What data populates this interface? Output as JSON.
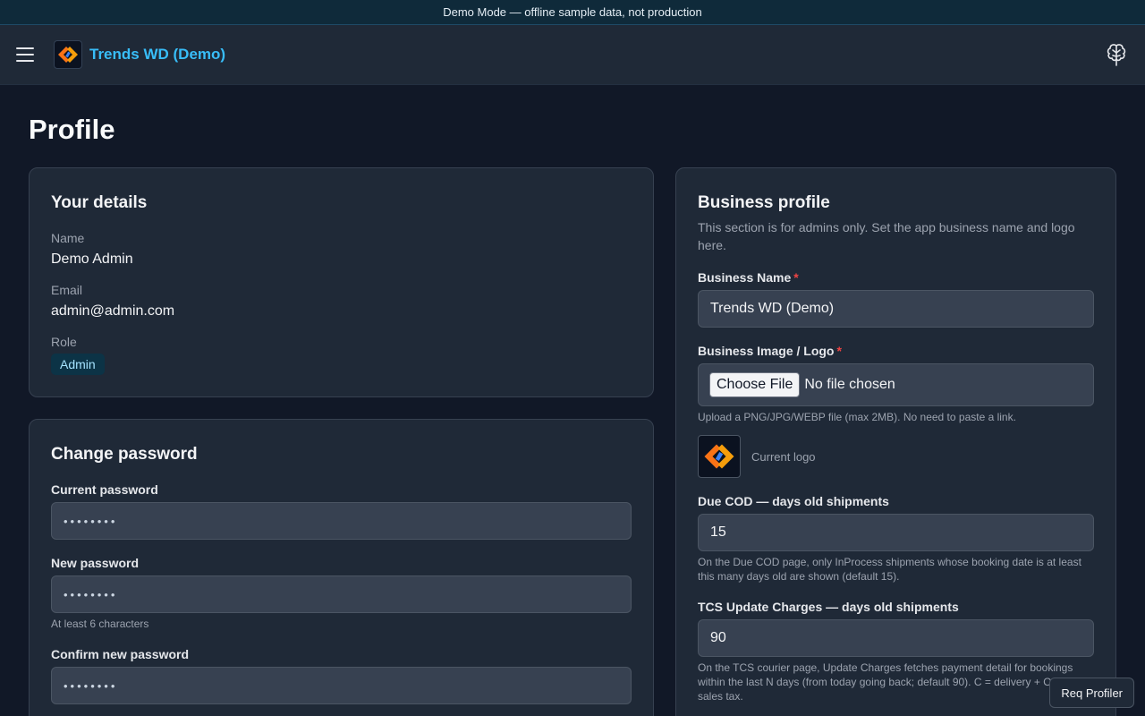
{
  "banner": {
    "text": "Demo Mode — offline sample data, not production"
  },
  "header": {
    "brand_name": "Trends WD (Demo)",
    "menu_icon": "hamburger-icon",
    "user_icon": "brain-icon"
  },
  "page": {
    "title": "Profile"
  },
  "details": {
    "title": "Your details",
    "name_label": "Name",
    "name_value": "Demo Admin",
    "email_label": "Email",
    "email_value": "admin@admin.com",
    "role_label": "Role",
    "role_value": "Admin"
  },
  "password": {
    "title": "Change password",
    "current_label": "Current password",
    "current_value": "••••••••",
    "new_label": "New password",
    "new_value": "••••••••",
    "new_help": "At least 6 characters",
    "confirm_label": "Confirm new password",
    "confirm_value": "••••••••"
  },
  "business": {
    "title": "Business profile",
    "description": "This section is for admins only. Set the app business name and logo here.",
    "name_label": "Business Name",
    "name_value": "Trends WD (Demo)",
    "logo_label": "Business Image / Logo",
    "file_button": "Choose File",
    "file_status": "No file chosen",
    "upload_help": "Upload a PNG/JPG/WEBP file (max 2MB). No need to paste a link.",
    "current_logo_label": "Current logo",
    "due_cod_label": "Due COD — days old shipments",
    "due_cod_value": "15",
    "due_cod_help": "On the Due COD page, only InProcess shipments whose booking date is at least this many days old are shown (default 15).",
    "tcs_label": "TCS Update Charges — days old shipments",
    "tcs_value": "90",
    "tcs_help": "On the TCS courier page, Update Charges fetches payment detail for bookings within the last N days (from today going back; default 90). C = delivery + OSA + sales tax."
  },
  "profiler": {
    "label": "Req Profiler"
  },
  "colors": {
    "accent": "#38bdf8",
    "required": "#ef4444",
    "background": "#111827",
    "card": "#1f2937"
  }
}
